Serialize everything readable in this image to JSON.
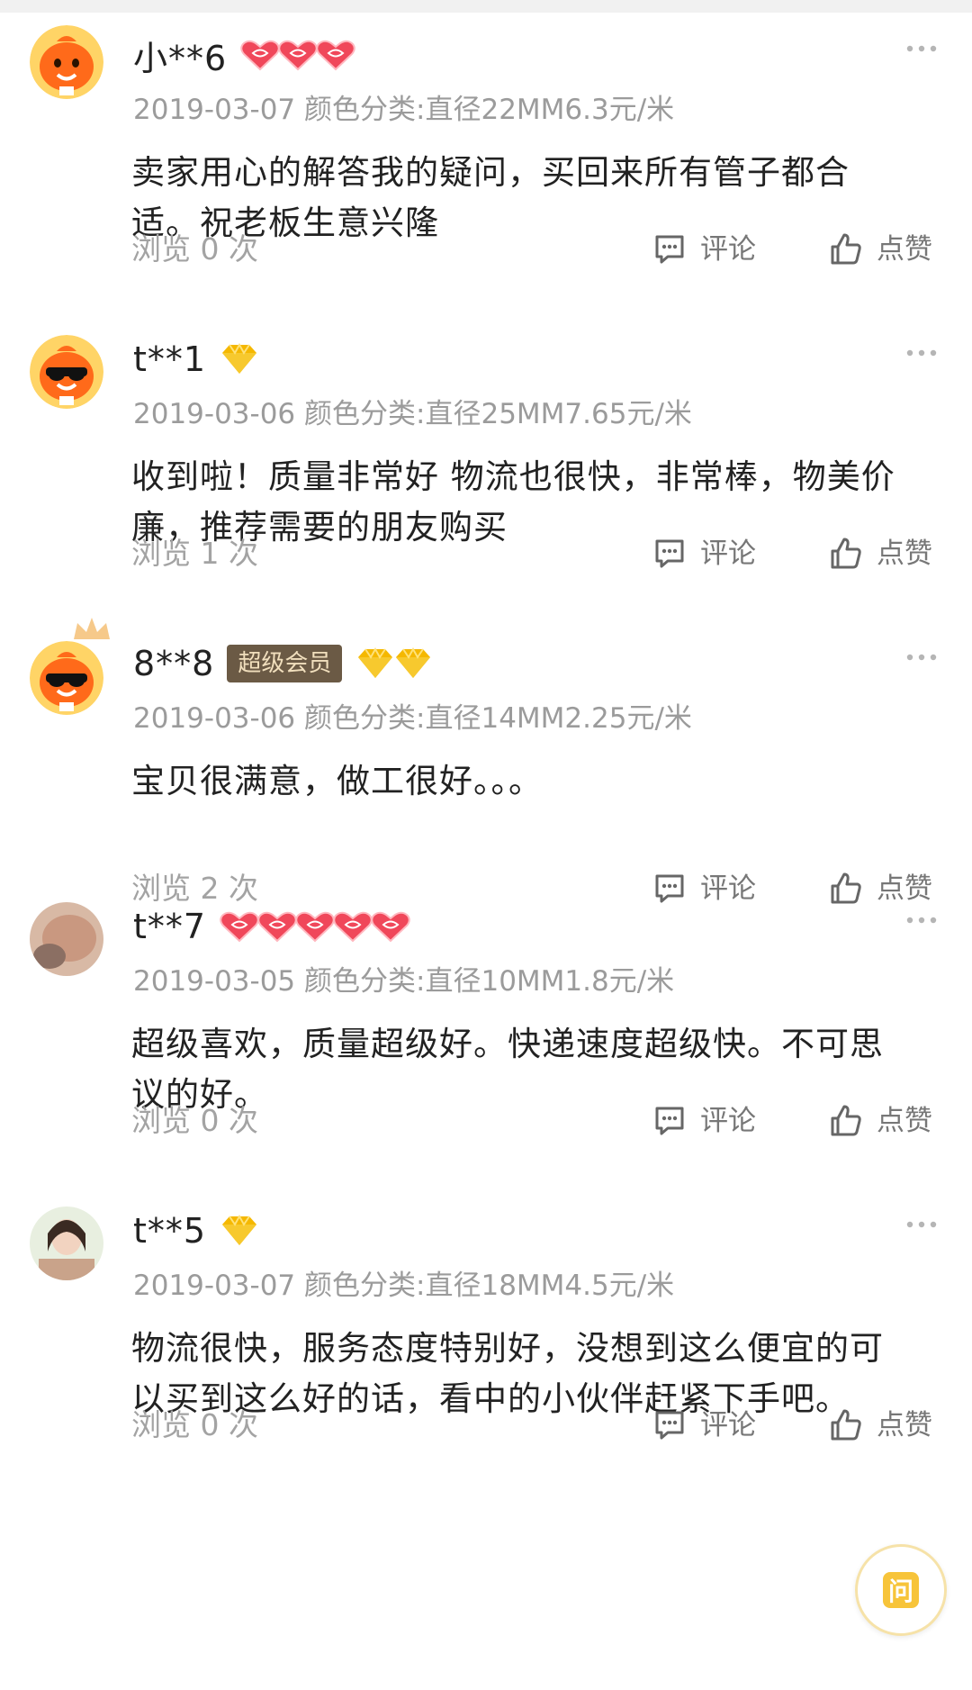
{
  "colors": {
    "accent_gold": "#f7c43a",
    "vip_badge_bg": "#6b5a45",
    "vip_badge_text": "#f1dfbd",
    "muted_text": "#9b9b9b",
    "heart_red": "#f0475a",
    "diamond_gold": "#f5b800"
  },
  "reviews": [
    {
      "avatar_icon": "orange-mascot-icon",
      "username": "小**6",
      "level_icon": "heart-icon",
      "level_count": 3,
      "vip_badge": "",
      "date": "2019-03-07",
      "sku": "颜色分类:直径22MM6.3元/米",
      "content": "卖家用心的解答我的疑问，买回来所有管子都合适。祝老板生意兴隆",
      "views": "浏览 0 次",
      "comment_label": "评论",
      "like_label": "点赞"
    },
    {
      "avatar_icon": "sunglasses-mascot-icon",
      "username": "t**1",
      "level_icon": "diamond-icon",
      "level_count": 1,
      "vip_badge": "",
      "date": "2019-03-06",
      "sku": "颜色分类:直径25MM7.65元/米",
      "content": "收到啦！质量非常好 物流也很快，非常棒，物美价廉，推荐需要的朋友购买",
      "views": "浏览 1 次",
      "comment_label": "评论",
      "like_label": "点赞"
    },
    {
      "avatar_icon": "sunglasses-mascot-crown-icon",
      "username": "8**8",
      "level_icon": "diamond-icon",
      "level_count": 2,
      "vip_badge": "超级会员",
      "date": "2019-03-06",
      "sku": "颜色分类:直径14MM2.25元/米",
      "content": "宝贝很满意，做工很好。。。",
      "views": "浏览 2 次",
      "comment_label": "评论",
      "like_label": "点赞"
    },
    {
      "avatar_icon": "photo-avatar-icon",
      "username": "t**7",
      "level_icon": "heart-icon",
      "level_count": 5,
      "vip_badge": "",
      "date": "2019-03-05",
      "sku": "颜色分类:直径10MM1.8元/米",
      "content": "超级喜欢，质量超级好。快递速度超级快。不可思议的好。",
      "views": "浏览 0 次",
      "comment_label": "评论",
      "like_label": "点赞"
    },
    {
      "avatar_icon": "photo-avatar-icon",
      "username": "t**5",
      "level_icon": "diamond-icon",
      "level_count": 1,
      "vip_badge": "",
      "date": "2019-03-07",
      "sku": "颜色分类:直径18MM4.5元/米",
      "content": "物流很快，服务态度特别好，没想到这么便宜的可以买到这么好的话，看中的小伙伴赶紧下手吧。",
      "views": "浏览 0 次",
      "comment_label": "评论",
      "like_label": "点赞"
    }
  ],
  "ask_button": {
    "label": "问",
    "icon": "ask-icon"
  }
}
